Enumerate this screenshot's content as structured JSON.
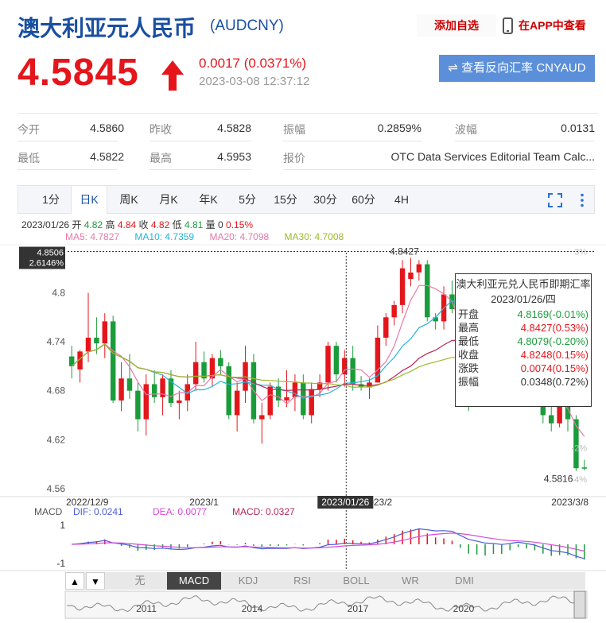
{
  "header": {
    "title": "澳大利亚元人民币",
    "code": "(AUDCNY)",
    "add_fav": "添加自选",
    "app_view": "在APP中查看"
  },
  "quote": {
    "price": "4.5845",
    "change": "0.0017 (0.0371%)",
    "timestamp": "2023-03-08 12:37:12",
    "reverse_label": "⇌ 查看反向汇率 CNYAUD",
    "up_color": "#e4161c"
  },
  "stats": {
    "open_label": "今开",
    "open_value": "4.5860",
    "prev_label": "昨收",
    "prev_value": "4.5828",
    "amp_label": "振幅",
    "amp_value": "0.2859%",
    "wave_label": "波幅",
    "wave_value": "0.0131",
    "low_label": "最低",
    "low_value": "4.5822",
    "high_label": "最高",
    "high_value": "4.5953",
    "quote_label": "报价",
    "quote_value": "OTC Data Services Editorial Team Calc..."
  },
  "tabs": [
    "1分",
    "日K",
    "周K",
    "月K",
    "年K",
    "5分",
    "15分",
    "30分",
    "60分",
    "4H"
  ],
  "active_tab": "日K",
  "info_line": {
    "date": "2023/01/26",
    "open_label": "开",
    "open": "4.82",
    "high_label": "高",
    "high": "4.84",
    "close_label": "收",
    "close": "4.82",
    "low_label": "低",
    "low": "4.81",
    "vol_label": "量",
    "vol": "0",
    "pct": "0.15%"
  },
  "ma": {
    "ma5": "MA5: 4.7827",
    "ma10": "MA10: 4.7359",
    "ma20": "MA20: 4.7098",
    "ma30": "MA30: 4.7008"
  },
  "macd_legend": {
    "name": "MACD",
    "dif": "DIF: 0.0241",
    "dea": "DEA: 0.0077",
    "macd": "MACD: 0.0327"
  },
  "tooltip": {
    "title": "澳大利亚元兑人民币即期汇率",
    "date": "2023/01/26/四",
    "rows": [
      {
        "k": "开盘",
        "v": "4.8169(-0.01%)",
        "color": "#1a9c3a"
      },
      {
        "k": "最高",
        "v": "4.8427(0.53%)",
        "color": "#e4161c"
      },
      {
        "k": "最低",
        "v": "4.8079(-0.20%)",
        "color": "#1a9c3a"
      },
      {
        "k": "收盘",
        "v": "4.8248(0.15%)",
        "color": "#e4161c"
      },
      {
        "k": "涨跌",
        "v": "0.0074(0.15%)",
        "color": "#e4161c"
      },
      {
        "k": "振幅",
        "v": "0.0348(0.72%)",
        "color": "#333333"
      }
    ]
  },
  "indicator_tabs": [
    "无",
    "MACD",
    "KDJ",
    "RSI",
    "BOLL",
    "WR",
    "DMI"
  ],
  "active_indicator": "MACD",
  "chart_data": {
    "type": "candlestick",
    "y_ticks": [
      "4.8",
      "4.74",
      "4.68",
      "4.62",
      "4.56"
    ],
    "y_tick_values": [
      4.8,
      4.74,
      4.68,
      4.62,
      4.56
    ],
    "ylim": [
      4.555,
      4.855
    ],
    "pct_ticks": [
      "3%",
      "-2%",
      "-4%"
    ],
    "pct_tick_values": [
      4.8506,
      4.61,
      4.5716
    ],
    "x_labels": [
      "2022/12/9",
      "2023/1",
      "2023/2",
      "2023/3/8"
    ],
    "x_label_indices": [
      0,
      16,
      37,
      62
    ],
    "crosshair": {
      "price": "4.8506",
      "pct": "2.6146%",
      "date": "2023/01/26",
      "index": 33
    },
    "high_label": "4.8427",
    "low_label": "4.5816",
    "candles": [
      {
        "o": 4.722,
        "h": 4.735,
        "l": 4.695,
        "c": 4.71
      },
      {
        "o": 4.706,
        "h": 4.73,
        "l": 4.69,
        "c": 4.728
      },
      {
        "o": 4.728,
        "h": 4.8,
        "l": 4.715,
        "c": 4.745
      },
      {
        "o": 4.745,
        "h": 4.77,
        "l": 4.725,
        "c": 4.738
      },
      {
        "o": 4.738,
        "h": 4.775,
        "l": 4.72,
        "c": 4.765
      },
      {
        "o": 4.765,
        "h": 4.772,
        "l": 4.665,
        "c": 4.668
      },
      {
        "o": 4.668,
        "h": 4.715,
        "l": 4.655,
        "c": 4.695
      },
      {
        "o": 4.695,
        "h": 4.725,
        "l": 4.67,
        "c": 4.68
      },
      {
        "o": 4.68,
        "h": 4.69,
        "l": 4.63,
        "c": 4.645
      },
      {
        "o": 4.645,
        "h": 4.7,
        "l": 4.625,
        "c": 4.688
      },
      {
        "o": 4.688,
        "h": 4.705,
        "l": 4.665,
        "c": 4.672
      },
      {
        "o": 4.672,
        "h": 4.7,
        "l": 4.65,
        "c": 4.695
      },
      {
        "o": 4.695,
        "h": 4.705,
        "l": 4.66,
        "c": 4.665
      },
      {
        "o": 4.665,
        "h": 4.68,
        "l": 4.645,
        "c": 4.668
      },
      {
        "o": 4.668,
        "h": 4.7,
        "l": 4.655,
        "c": 4.688
      },
      {
        "o": 4.688,
        "h": 4.74,
        "l": 4.68,
        "c": 4.715
      },
      {
        "o": 4.715,
        "h": 4.728,
        "l": 4.69,
        "c": 4.695
      },
      {
        "o": 4.695,
        "h": 4.725,
        "l": 4.685,
        "c": 4.72
      },
      {
        "o": 4.72,
        "h": 4.73,
        "l": 4.7,
        "c": 4.71
      },
      {
        "o": 4.71,
        "h": 4.715,
        "l": 4.645,
        "c": 4.65
      },
      {
        "o": 4.65,
        "h": 4.69,
        "l": 4.63,
        "c": 4.68
      },
      {
        "o": 4.68,
        "h": 4.735,
        "l": 4.665,
        "c": 4.715
      },
      {
        "o": 4.715,
        "h": 4.725,
        "l": 4.64,
        "c": 4.645
      },
      {
        "o": 4.645,
        "h": 4.665,
        "l": 4.615,
        "c": 4.65
      },
      {
        "o": 4.65,
        "h": 4.69,
        "l": 4.645,
        "c": 4.685
      },
      {
        "o": 4.685,
        "h": 4.695,
        "l": 4.66,
        "c": 4.668
      },
      {
        "o": 4.668,
        "h": 4.705,
        "l": 4.66,
        "c": 4.672
      },
      {
        "o": 4.672,
        "h": 4.7,
        "l": 4.655,
        "c": 4.69
      },
      {
        "o": 4.69,
        "h": 4.7,
        "l": 4.645,
        "c": 4.65
      },
      {
        "o": 4.65,
        "h": 4.69,
        "l": 4.64,
        "c": 4.682
      },
      {
        "o": 4.682,
        "h": 4.7,
        "l": 4.672,
        "c": 4.69
      },
      {
        "o": 4.69,
        "h": 4.74,
        "l": 4.68,
        "c": 4.735
      },
      {
        "o": 4.735,
        "h": 4.74,
        "l": 4.69,
        "c": 4.7
      },
      {
        "o": 4.7,
        "h": 4.73,
        "l": 4.685,
        "c": 4.72
      },
      {
        "o": 4.72,
        "h": 4.735,
        "l": 4.68,
        "c": 4.688
      },
      {
        "o": 4.688,
        "h": 4.698,
        "l": 4.68,
        "c": 4.684
      },
      {
        "o": 4.684,
        "h": 4.695,
        "l": 4.67,
        "c": 4.69
      },
      {
        "o": 4.69,
        "h": 4.76,
        "l": 4.69,
        "c": 4.745
      },
      {
        "o": 4.745,
        "h": 4.775,
        "l": 4.735,
        "c": 4.77
      },
      {
        "o": 4.77,
        "h": 4.79,
        "l": 4.76,
        "c": 4.785
      },
      {
        "o": 4.785,
        "h": 4.84,
        "l": 4.775,
        "c": 4.83
      },
      {
        "o": 4.8169,
        "h": 4.8427,
        "l": 4.8079,
        "c": 4.8248
      },
      {
        "o": 4.825,
        "h": 4.84,
        "l": 4.815,
        "c": 4.835
      },
      {
        "o": 4.835,
        "h": 4.84,
        "l": 4.765,
        "c": 4.77
      },
      {
        "o": 4.77,
        "h": 4.775,
        "l": 4.755,
        "c": 4.765
      },
      {
        "o": 4.765,
        "h": 4.808,
        "l": 4.755,
        "c": 4.798
      },
      {
        "o": 4.798,
        "h": 4.815,
        "l": 4.775,
        "c": 4.78
      },
      {
        "o": 4.78,
        "h": 4.79,
        "l": 4.68,
        "c": 4.69
      },
      {
        "o": 4.69,
        "h": 4.715,
        "l": 4.655,
        "c": 4.67
      },
      {
        "o": 4.67,
        "h": 4.72,
        "l": 4.665,
        "c": 4.71
      },
      {
        "o": 4.71,
        "h": 4.72,
        "l": 4.69,
        "c": 4.695
      },
      {
        "o": 4.695,
        "h": 4.73,
        "l": 4.69,
        "c": 4.725
      },
      {
        "o": 4.725,
        "h": 4.74,
        "l": 4.7,
        "c": 4.705
      },
      {
        "o": 4.705,
        "h": 4.76,
        "l": 4.7,
        "c": 4.755
      },
      {
        "o": 4.755,
        "h": 4.772,
        "l": 4.745,
        "c": 4.765
      },
      {
        "o": 4.765,
        "h": 4.77,
        "l": 4.7,
        "c": 4.71
      },
      {
        "o": 4.71,
        "h": 4.74,
        "l": 4.68,
        "c": 4.69
      },
      {
        "o": 4.69,
        "h": 4.715,
        "l": 4.64,
        "c": 4.65
      },
      {
        "o": 4.65,
        "h": 4.67,
        "l": 4.63,
        "c": 4.64
      },
      {
        "o": 4.64,
        "h": 4.675,
        "l": 4.635,
        "c": 4.665
      },
      {
        "o": 4.665,
        "h": 4.68,
        "l": 4.63,
        "c": 4.645
      },
      {
        "o": 4.645,
        "h": 4.65,
        "l": 4.5816,
        "c": 4.585
      },
      {
        "o": 4.586,
        "h": 4.5953,
        "l": 4.5822,
        "c": 4.5845
      }
    ],
    "ma_series": [
      {
        "name": "MA5",
        "color": "#e879a6"
      },
      {
        "name": "MA10",
        "color": "#25b5d8"
      },
      {
        "name": "MA20",
        "color": "#b8285a"
      },
      {
        "name": "MA30",
        "color": "#9aba2a"
      }
    ],
    "macd": {
      "ylim": [
        -1.3,
        1.3
      ],
      "y_ticks": [
        "1",
        "-1"
      ],
      "y_tick_values": [
        1,
        -1
      ],
      "dif_color": "#4a5ed6",
      "dea_color": "#d84ad8"
    },
    "navigator_labels": [
      "2011",
      "2014",
      "2017",
      "2020"
    ]
  }
}
